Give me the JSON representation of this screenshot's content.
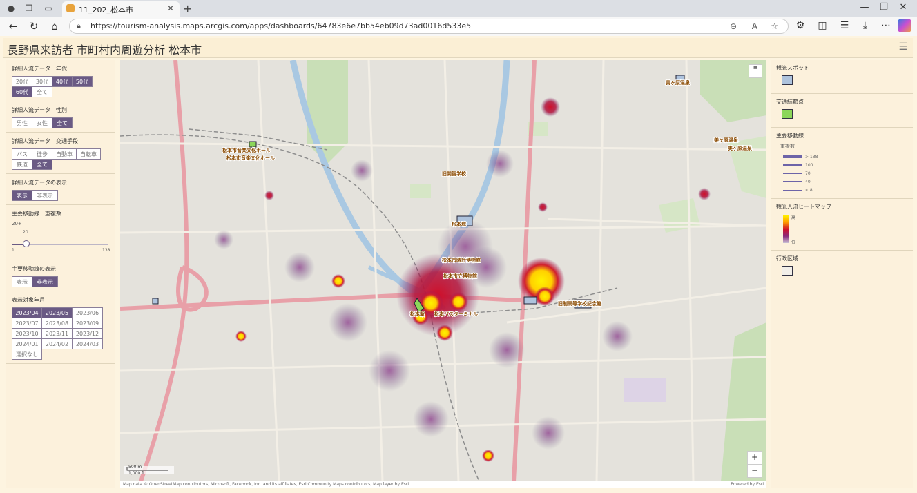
{
  "browser": {
    "tab_title": "11_202_松本市",
    "url": "https://tourism-analysis.maps.arcgis.com/apps/dashboards/64783e6e7bb54eb09d73ad0016d533e5"
  },
  "header": {
    "title": "長野県来訪者 市町村内周遊分析 松本市"
  },
  "filters": {
    "age": {
      "title": "詳細人流データ　年代",
      "options": [
        "20代",
        "30代",
        "40代",
        "50代",
        "60代",
        "全て"
      ]
    },
    "gender": {
      "title": "詳細人流データ　性別",
      "options": [
        "男性",
        "女性",
        "全て"
      ]
    },
    "transport": {
      "title": "詳細人流データ　交通手段",
      "options": [
        "バス",
        "徒歩",
        "自動車",
        "自転車",
        "鉄道",
        "全て"
      ]
    },
    "display": {
      "title": "詳細人流データの表示",
      "options": [
        "表示",
        "非表示"
      ]
    },
    "weight": {
      "title": "主要移動線　重複数",
      "value_label": "20+",
      "thumb_label": "20",
      "min": "1",
      "max": "138",
      "value": 20
    },
    "lines_display": {
      "title": "主要移動線の表示",
      "options": [
        "表示",
        "非表示"
      ]
    },
    "months": {
      "title": "表示対象年月",
      "options": [
        "2023/04",
        "2023/05",
        "2023/06",
        "2023/07",
        "2023/08",
        "2023/09",
        "2023/10",
        "2023/11",
        "2023/12",
        "2024/01",
        "2024/02",
        "2024/03",
        "選択なし"
      ]
    }
  },
  "map": {
    "labels": [
      "松本市音楽文化ホール",
      "松本市音楽文化ホール",
      "旧開智学校",
      "松本城",
      "松本市時計博物館",
      "松本市立博物館",
      "旧制高等学校記念館",
      "美ヶ原温泉",
      "美ヶ原温泉",
      "美ヶ原温泉",
      "松本駅",
      "松本バスターミナル"
    ],
    "scale": {
      "metric": "500 m",
      "imperial": "1,000 ft"
    },
    "zoom_in": "+",
    "zoom_out": "−",
    "attribution": "Map data © OpenStreetMap contributors, Microsoft, Facebook, Inc. and its affiliates, Esri Community Maps contributors, Map layer by Esri",
    "powered": "Powered by Esri"
  },
  "legend": {
    "spot": {
      "title": "観光スポット"
    },
    "node": {
      "title": "交通結節点"
    },
    "lines": {
      "title": "主要移動線",
      "subtitle": "重複数",
      "items": [
        "> 138",
        "100",
        "70",
        "40",
        "< 8"
      ]
    },
    "heatmap": {
      "title": "観光人流ヒートマップ",
      "high": "高",
      "low": "低"
    },
    "admin": {
      "title": "行政区域"
    }
  },
  "colors": {
    "selected": "#6a5a84",
    "panel": "#fcf1dc",
    "heat_high": "#ffe800",
    "heat_mid": "#c8102e",
    "heat_low": "#6a5a84"
  }
}
